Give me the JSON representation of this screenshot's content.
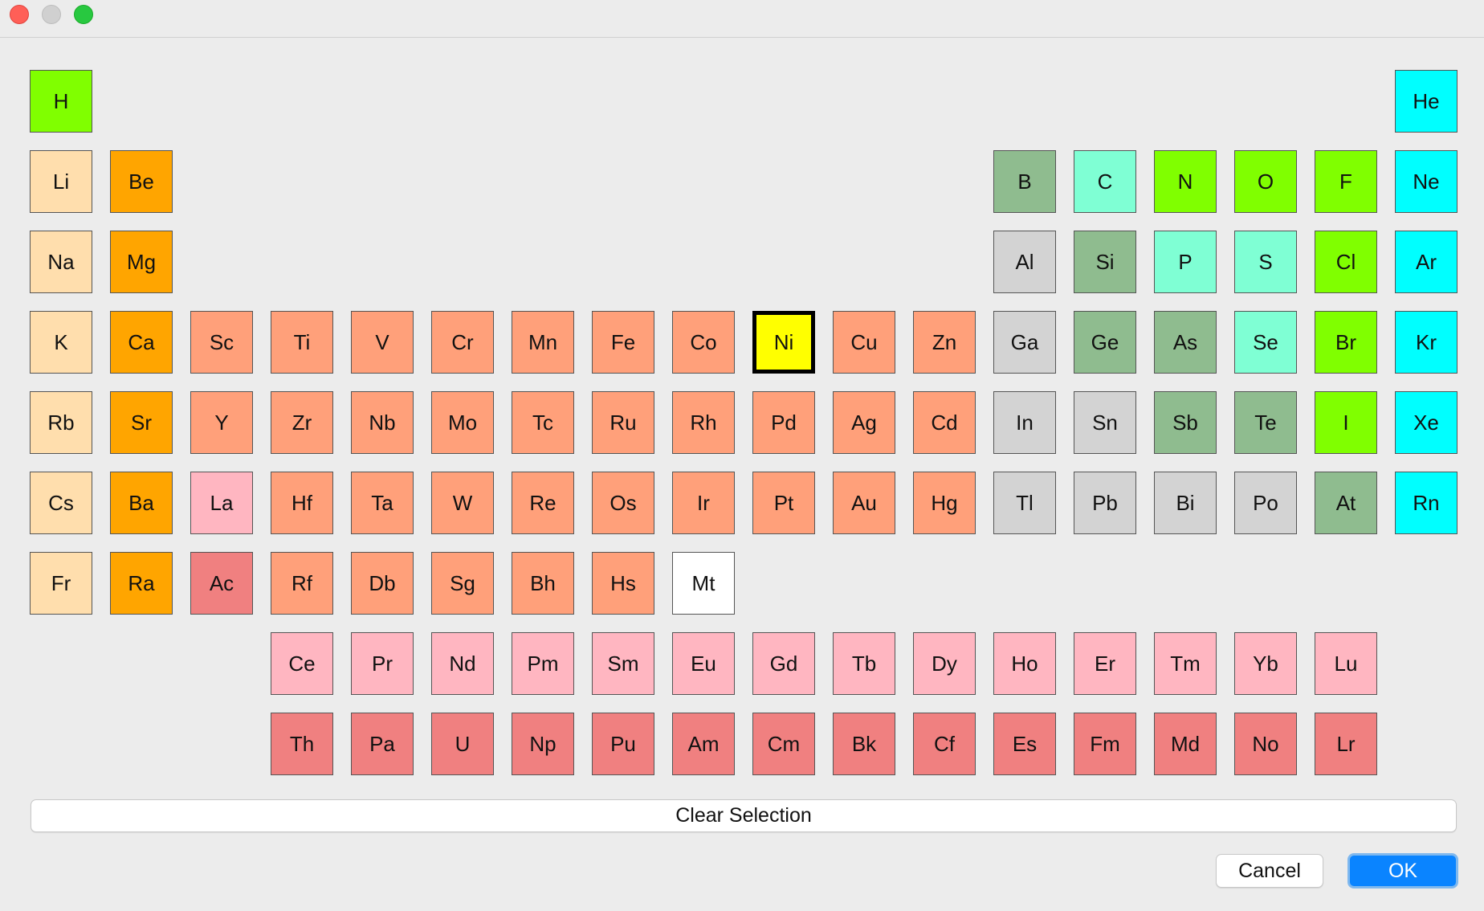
{
  "window": {
    "controls": [
      "close-button",
      "minimize-button",
      "zoom-button"
    ]
  },
  "colors": {
    "nonmetal": "#80ff00",
    "noble_gas": "#00ffff",
    "alkali_metal": "#ffdead",
    "alkaline_earth": "#ffa500",
    "transition_metal": "#ffa07a",
    "lanthanide": "#ffb6c1",
    "actinide": "#f08080",
    "metalloid": "#8fbc8f",
    "post_transition": "#d3d3d3",
    "polyatomic_nonmetal": "#7fffd4",
    "unknown": "#ffffff",
    "selected": "#ffff00"
  },
  "selected_element": "Ni",
  "elements": [
    {
      "symbol": "H",
      "row": 1,
      "col": 1,
      "cat": "nonmetal"
    },
    {
      "symbol": "He",
      "row": 1,
      "col": 18,
      "cat": "noble_gas"
    },
    {
      "symbol": "Li",
      "row": 2,
      "col": 1,
      "cat": "alkali_metal"
    },
    {
      "symbol": "Be",
      "row": 2,
      "col": 2,
      "cat": "alkaline_earth"
    },
    {
      "symbol": "B",
      "row": 2,
      "col": 13,
      "cat": "metalloid"
    },
    {
      "symbol": "C",
      "row": 2,
      "col": 14,
      "cat": "polyatomic_nonmetal"
    },
    {
      "symbol": "N",
      "row": 2,
      "col": 15,
      "cat": "nonmetal"
    },
    {
      "symbol": "O",
      "row": 2,
      "col": 16,
      "cat": "nonmetal"
    },
    {
      "symbol": "F",
      "row": 2,
      "col": 17,
      "cat": "nonmetal"
    },
    {
      "symbol": "Ne",
      "row": 2,
      "col": 18,
      "cat": "noble_gas"
    },
    {
      "symbol": "Na",
      "row": 3,
      "col": 1,
      "cat": "alkali_metal"
    },
    {
      "symbol": "Mg",
      "row": 3,
      "col": 2,
      "cat": "alkaline_earth"
    },
    {
      "symbol": "Al",
      "row": 3,
      "col": 13,
      "cat": "post_transition"
    },
    {
      "symbol": "Si",
      "row": 3,
      "col": 14,
      "cat": "metalloid"
    },
    {
      "symbol": "P",
      "row": 3,
      "col": 15,
      "cat": "polyatomic_nonmetal"
    },
    {
      "symbol": "S",
      "row": 3,
      "col": 16,
      "cat": "polyatomic_nonmetal"
    },
    {
      "symbol": "Cl",
      "row": 3,
      "col": 17,
      "cat": "nonmetal"
    },
    {
      "symbol": "Ar",
      "row": 3,
      "col": 18,
      "cat": "noble_gas"
    },
    {
      "symbol": "K",
      "row": 4,
      "col": 1,
      "cat": "alkali_metal"
    },
    {
      "symbol": "Ca",
      "row": 4,
      "col": 2,
      "cat": "alkaline_earth"
    },
    {
      "symbol": "Sc",
      "row": 4,
      "col": 3,
      "cat": "transition_metal"
    },
    {
      "symbol": "Ti",
      "row": 4,
      "col": 4,
      "cat": "transition_metal"
    },
    {
      "symbol": "V",
      "row": 4,
      "col": 5,
      "cat": "transition_metal"
    },
    {
      "symbol": "Cr",
      "row": 4,
      "col": 6,
      "cat": "transition_metal"
    },
    {
      "symbol": "Mn",
      "row": 4,
      "col": 7,
      "cat": "transition_metal"
    },
    {
      "symbol": "Fe",
      "row": 4,
      "col": 8,
      "cat": "transition_metal"
    },
    {
      "symbol": "Co",
      "row": 4,
      "col": 9,
      "cat": "transition_metal"
    },
    {
      "symbol": "Ni",
      "row": 4,
      "col": 10,
      "cat": "selected"
    },
    {
      "symbol": "Cu",
      "row": 4,
      "col": 11,
      "cat": "transition_metal"
    },
    {
      "symbol": "Zn",
      "row": 4,
      "col": 12,
      "cat": "transition_metal"
    },
    {
      "symbol": "Ga",
      "row": 4,
      "col": 13,
      "cat": "post_transition"
    },
    {
      "symbol": "Ge",
      "row": 4,
      "col": 14,
      "cat": "metalloid"
    },
    {
      "symbol": "As",
      "row": 4,
      "col": 15,
      "cat": "metalloid"
    },
    {
      "symbol": "Se",
      "row": 4,
      "col": 16,
      "cat": "polyatomic_nonmetal"
    },
    {
      "symbol": "Br",
      "row": 4,
      "col": 17,
      "cat": "nonmetal"
    },
    {
      "symbol": "Kr",
      "row": 4,
      "col": 18,
      "cat": "noble_gas"
    },
    {
      "symbol": "Rb",
      "row": 5,
      "col": 1,
      "cat": "alkali_metal"
    },
    {
      "symbol": "Sr",
      "row": 5,
      "col": 2,
      "cat": "alkaline_earth"
    },
    {
      "symbol": "Y",
      "row": 5,
      "col": 3,
      "cat": "transition_metal"
    },
    {
      "symbol": "Zr",
      "row": 5,
      "col": 4,
      "cat": "transition_metal"
    },
    {
      "symbol": "Nb",
      "row": 5,
      "col": 5,
      "cat": "transition_metal"
    },
    {
      "symbol": "Mo",
      "row": 5,
      "col": 6,
      "cat": "transition_metal"
    },
    {
      "symbol": "Tc",
      "row": 5,
      "col": 7,
      "cat": "transition_metal"
    },
    {
      "symbol": "Ru",
      "row": 5,
      "col": 8,
      "cat": "transition_metal"
    },
    {
      "symbol": "Rh",
      "row": 5,
      "col": 9,
      "cat": "transition_metal"
    },
    {
      "symbol": "Pd",
      "row": 5,
      "col": 10,
      "cat": "transition_metal"
    },
    {
      "symbol": "Ag",
      "row": 5,
      "col": 11,
      "cat": "transition_metal"
    },
    {
      "symbol": "Cd",
      "row": 5,
      "col": 12,
      "cat": "transition_metal"
    },
    {
      "symbol": "In",
      "row": 5,
      "col": 13,
      "cat": "post_transition"
    },
    {
      "symbol": "Sn",
      "row": 5,
      "col": 14,
      "cat": "post_transition"
    },
    {
      "symbol": "Sb",
      "row": 5,
      "col": 15,
      "cat": "metalloid"
    },
    {
      "symbol": "Te",
      "row": 5,
      "col": 16,
      "cat": "metalloid"
    },
    {
      "symbol": "I",
      "row": 5,
      "col": 17,
      "cat": "nonmetal"
    },
    {
      "symbol": "Xe",
      "row": 5,
      "col": 18,
      "cat": "noble_gas"
    },
    {
      "symbol": "Cs",
      "row": 6,
      "col": 1,
      "cat": "alkali_metal"
    },
    {
      "symbol": "Ba",
      "row": 6,
      "col": 2,
      "cat": "alkaline_earth"
    },
    {
      "symbol": "La",
      "row": 6,
      "col": 3,
      "cat": "lanthanide"
    },
    {
      "symbol": "Hf",
      "row": 6,
      "col": 4,
      "cat": "transition_metal"
    },
    {
      "symbol": "Ta",
      "row": 6,
      "col": 5,
      "cat": "transition_metal"
    },
    {
      "symbol": "W",
      "row": 6,
      "col": 6,
      "cat": "transition_metal"
    },
    {
      "symbol": "Re",
      "row": 6,
      "col": 7,
      "cat": "transition_metal"
    },
    {
      "symbol": "Os",
      "row": 6,
      "col": 8,
      "cat": "transition_metal"
    },
    {
      "symbol": "Ir",
      "row": 6,
      "col": 9,
      "cat": "transition_metal"
    },
    {
      "symbol": "Pt",
      "row": 6,
      "col": 10,
      "cat": "transition_metal"
    },
    {
      "symbol": "Au",
      "row": 6,
      "col": 11,
      "cat": "transition_metal"
    },
    {
      "symbol": "Hg",
      "row": 6,
      "col": 12,
      "cat": "transition_metal"
    },
    {
      "symbol": "Tl",
      "row": 6,
      "col": 13,
      "cat": "post_transition"
    },
    {
      "symbol": "Pb",
      "row": 6,
      "col": 14,
      "cat": "post_transition"
    },
    {
      "symbol": "Bi",
      "row": 6,
      "col": 15,
      "cat": "post_transition"
    },
    {
      "symbol": "Po",
      "row": 6,
      "col": 16,
      "cat": "post_transition"
    },
    {
      "symbol": "At",
      "row": 6,
      "col": 17,
      "cat": "metalloid"
    },
    {
      "symbol": "Rn",
      "row": 6,
      "col": 18,
      "cat": "noble_gas"
    },
    {
      "symbol": "Fr",
      "row": 7,
      "col": 1,
      "cat": "alkali_metal"
    },
    {
      "symbol": "Ra",
      "row": 7,
      "col": 2,
      "cat": "alkaline_earth"
    },
    {
      "symbol": "Ac",
      "row": 7,
      "col": 3,
      "cat": "actinide"
    },
    {
      "symbol": "Rf",
      "row": 7,
      "col": 4,
      "cat": "transition_metal"
    },
    {
      "symbol": "Db",
      "row": 7,
      "col": 5,
      "cat": "transition_metal"
    },
    {
      "symbol": "Sg",
      "row": 7,
      "col": 6,
      "cat": "transition_metal"
    },
    {
      "symbol": "Bh",
      "row": 7,
      "col": 7,
      "cat": "transition_metal"
    },
    {
      "symbol": "Hs",
      "row": 7,
      "col": 8,
      "cat": "transition_metal"
    },
    {
      "symbol": "Mt",
      "row": 7,
      "col": 9,
      "cat": "unknown"
    },
    {
      "symbol": "Ce",
      "row": 8,
      "col": 4,
      "cat": "lanthanide"
    },
    {
      "symbol": "Pr",
      "row": 8,
      "col": 5,
      "cat": "lanthanide"
    },
    {
      "symbol": "Nd",
      "row": 8,
      "col": 6,
      "cat": "lanthanide"
    },
    {
      "symbol": "Pm",
      "row": 8,
      "col": 7,
      "cat": "lanthanide"
    },
    {
      "symbol": "Sm",
      "row": 8,
      "col": 8,
      "cat": "lanthanide"
    },
    {
      "symbol": "Eu",
      "row": 8,
      "col": 9,
      "cat": "lanthanide"
    },
    {
      "symbol": "Gd",
      "row": 8,
      "col": 10,
      "cat": "lanthanide"
    },
    {
      "symbol": "Tb",
      "row": 8,
      "col": 11,
      "cat": "lanthanide"
    },
    {
      "symbol": "Dy",
      "row": 8,
      "col": 12,
      "cat": "lanthanide"
    },
    {
      "symbol": "Ho",
      "row": 8,
      "col": 13,
      "cat": "lanthanide"
    },
    {
      "symbol": "Er",
      "row": 8,
      "col": 14,
      "cat": "lanthanide"
    },
    {
      "symbol": "Tm",
      "row": 8,
      "col": 15,
      "cat": "lanthanide"
    },
    {
      "symbol": "Yb",
      "row": 8,
      "col": 16,
      "cat": "lanthanide"
    },
    {
      "symbol": "Lu",
      "row": 8,
      "col": 17,
      "cat": "lanthanide"
    },
    {
      "symbol": "Th",
      "row": 9,
      "col": 4,
      "cat": "actinide"
    },
    {
      "symbol": "Pa",
      "row": 9,
      "col": 5,
      "cat": "actinide"
    },
    {
      "symbol": "U",
      "row": 9,
      "col": 6,
      "cat": "actinide"
    },
    {
      "symbol": "Np",
      "row": 9,
      "col": 7,
      "cat": "actinide"
    },
    {
      "symbol": "Pu",
      "row": 9,
      "col": 8,
      "cat": "actinide"
    },
    {
      "symbol": "Am",
      "row": 9,
      "col": 9,
      "cat": "actinide"
    },
    {
      "symbol": "Cm",
      "row": 9,
      "col": 10,
      "cat": "actinide"
    },
    {
      "symbol": "Bk",
      "row": 9,
      "col": 11,
      "cat": "actinide"
    },
    {
      "symbol": "Cf",
      "row": 9,
      "col": 12,
      "cat": "actinide"
    },
    {
      "symbol": "Es",
      "row": 9,
      "col": 13,
      "cat": "actinide"
    },
    {
      "symbol": "Fm",
      "row": 9,
      "col": 14,
      "cat": "actinide"
    },
    {
      "symbol": "Md",
      "row": 9,
      "col": 15,
      "cat": "actinide"
    },
    {
      "symbol": "No",
      "row": 9,
      "col": 16,
      "cat": "actinide"
    },
    {
      "symbol": "Lr",
      "row": 9,
      "col": 17,
      "cat": "actinide"
    }
  ],
  "buttons": {
    "clear_selection": "Clear Selection",
    "cancel": "Cancel",
    "ok": "OK"
  }
}
